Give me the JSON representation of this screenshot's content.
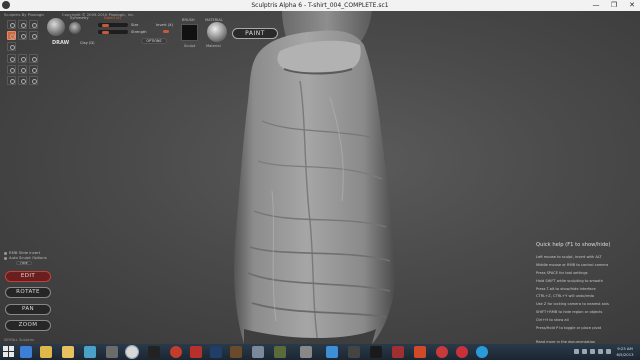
{
  "window": {
    "title": "Sculptris Alpha 6 - T-shirt_004_COMPLETE.sc1",
    "minimize_label": "—",
    "maximize_label": "❐",
    "close_label": "✕"
  },
  "menubar": {
    "brand": "Sculptris By Pixologic",
    "copyright": "Copyright © 2009-2010 Pixologic, Inc."
  },
  "toolbar": {
    "brush_tab": "Brush",
    "symmetry_tab": "Symmetry",
    "detail_label": "Detail (X)",
    "size_label": "Size",
    "strength_label": "Strength",
    "invert_label": "Invert (X)",
    "options_label": "OPTIONS",
    "clay_label": "Clay (D)",
    "draw_label": "DRAW",
    "brush_header": "BRUSH",
    "brush_sub": "Sculpt",
    "material_header": "MATERIAL",
    "material_sub": "Material",
    "paint_label": "PAINT"
  },
  "left_panel": {
    "rmb_label": "RMB Slide invert",
    "auto_label": "Auto Sculpt Options",
    "hide_label": "HIDE",
    "modes": [
      "EDIT",
      "ROTATE",
      "PAN",
      "ZOOM"
    ],
    "footer": "SKYFALL Sculptris"
  },
  "help": {
    "title": "Quick help (F1 to show/hide)",
    "lines": [
      "Left mouse to sculpt, invert with ALT",
      "Middle mouse or RMB to control camera",
      "Press SPACE for tool settings",
      "Hold SHIFT while sculpting to smooth",
      "Press T-alt to show/hide interface",
      "CTRL+Z, CTRL+Y will undo/redo",
      "Use Z for locking camera to nearest axis",
      "SHIFT+RMB to hide region or objects",
      "Ctrl+H to show all",
      "Press/Hold P to toggle or place pivot"
    ],
    "footer": "Read more in the documentation"
  },
  "taskbar": {
    "time": "9:23 AM",
    "date": "6/5/2013"
  },
  "colors": {
    "accent": "#d0673e",
    "edit_active": "#6a1e1e",
    "viewport_bg": "#4a4a4a"
  }
}
